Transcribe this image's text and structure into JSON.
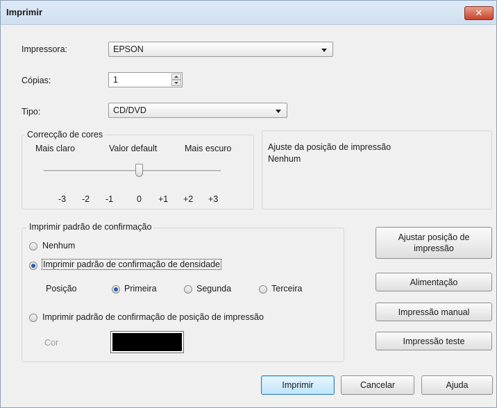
{
  "window": {
    "title": "Imprimir",
    "close_glyph": "✕"
  },
  "printer": {
    "label": "Impressora:",
    "value": "EPSON"
  },
  "copies": {
    "label": "Cópias:",
    "value": "1"
  },
  "type": {
    "label": "Tipo:",
    "value": "CD/DVD"
  },
  "color_correction": {
    "title": "Correcção de cores",
    "light_label": "Mais claro",
    "default_label": "Valor default",
    "dark_label": "Mais escuro",
    "ticks": [
      "-3",
      "-2",
      "-1",
      "0",
      "+1",
      "+2",
      "+3"
    ],
    "selected": "0"
  },
  "print_position": {
    "title": "Ajuste da posição de impressão",
    "value": "Nenhum"
  },
  "confirmation": {
    "title": "Imprimir padrão de confirmação",
    "none_label": "Nenhum",
    "density_label": "Imprimir padrão de confirmação de densidade",
    "position_label": "Posição",
    "first_label": "Primeira",
    "second_label": "Segunda",
    "third_label": "Terceira",
    "print_position_label": "Imprimir padrão de confirmação de posição de impressão",
    "color_label": "Cor",
    "color_value": "#000000"
  },
  "side_buttons": {
    "adjust_position": "Ajustar posição de impressão",
    "feed": "Alimentação",
    "manual": "Impressão manual",
    "test": "Impressão teste"
  },
  "footer": {
    "print": "Imprimir",
    "cancel": "Cancelar",
    "help": "Ajuda"
  }
}
